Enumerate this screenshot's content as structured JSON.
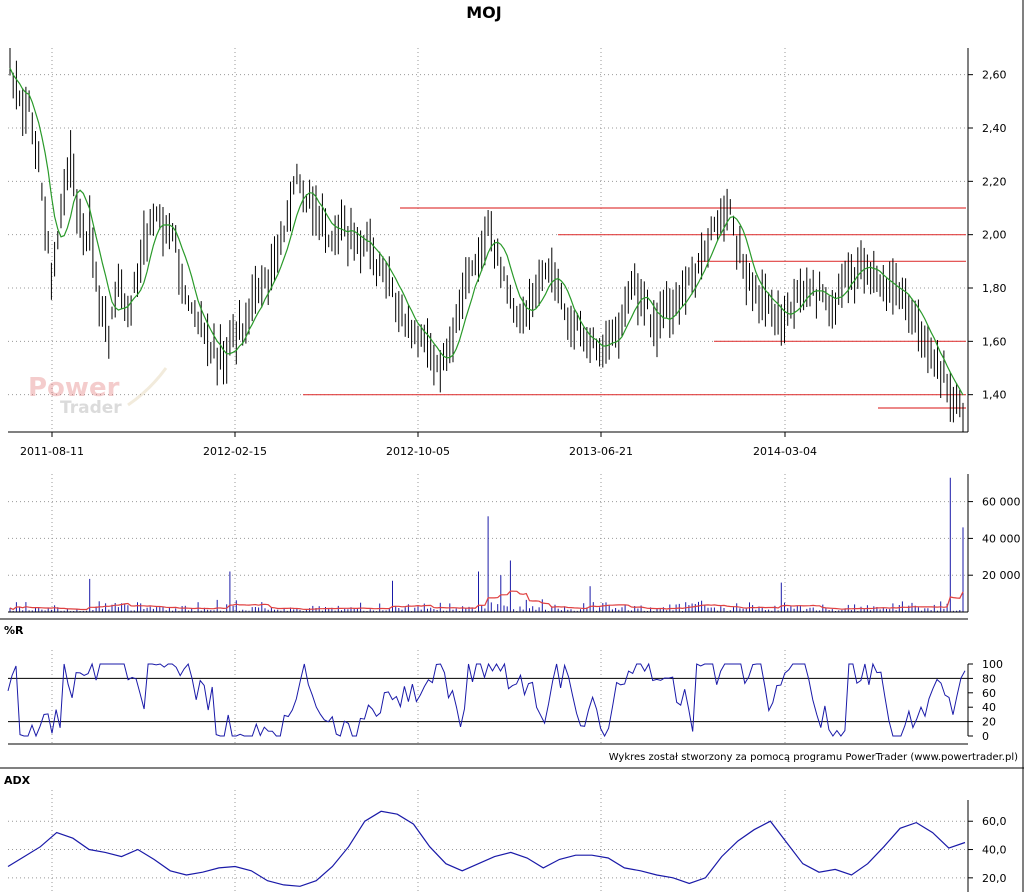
{
  "chart_data": [
    {
      "type": "ohlc",
      "title": "MOJ",
      "x_tick_labels": [
        "2011-08-11",
        "2012-02-15",
        "2012-10-05",
        "2013-06-21",
        "2014-03-04"
      ],
      "y_ticks": [
        "1,40",
        "1,60",
        "1,80",
        "2,00",
        "2,20",
        "2,40",
        "2,60"
      ],
      "ylim": [
        1.26,
        2.7
      ],
      "grid": true,
      "price_close": [
        2.62,
        2.55,
        2.45,
        2.48,
        2.35,
        2.2,
        2.0,
        1.82,
        2.05,
        2.2,
        2.28,
        2.1,
        1.98,
        2.02,
        1.85,
        1.72,
        1.6,
        1.75,
        1.8,
        1.7,
        1.78,
        1.9,
        2.0,
        2.05,
        2.1,
        1.98,
        2.02,
        1.95,
        1.8,
        1.75,
        1.7,
        1.65,
        1.6,
        1.58,
        1.55,
        1.52,
        1.6,
        1.62,
        1.65,
        1.72,
        1.78,
        1.8,
        1.85,
        1.9,
        1.98,
        2.05,
        2.18,
        2.2,
        2.15,
        2.1,
        2.08,
        2.05,
        1.98,
        2.02,
        2.06,
        2.0,
        1.98,
        1.96,
        1.95,
        1.92,
        1.88,
        1.85,
        1.8,
        1.72,
        1.7,
        1.65,
        1.62,
        1.6,
        1.58,
        1.55,
        1.5,
        1.56,
        1.62,
        1.75,
        1.8,
        1.85,
        1.9,
        1.98,
        2.05,
        1.95,
        1.85,
        1.8,
        1.72,
        1.68,
        1.7,
        1.75,
        1.8,
        1.85,
        1.88,
        1.8,
        1.72,
        1.66,
        1.65,
        1.63,
        1.6,
        1.58,
        1.57,
        1.6,
        1.62,
        1.65,
        1.72,
        1.8,
        1.78,
        1.75,
        1.7,
        1.66,
        1.68,
        1.72,
        1.75,
        1.78,
        1.8,
        1.85,
        1.9,
        1.95,
        2.0,
        2.05,
        2.08,
        2.1,
        2.02,
        1.88,
        1.85,
        1.8,
        1.78,
        1.75,
        1.7,
        1.7,
        1.68,
        1.72,
        1.75,
        1.78,
        1.8,
        1.78,
        1.75,
        1.72,
        1.76,
        1.8,
        1.86,
        1.88,
        1.86,
        1.9,
        1.88,
        1.85,
        1.82,
        1.8,
        1.78,
        1.76,
        1.74,
        1.7,
        1.66,
        1.62,
        1.56,
        1.5,
        1.45,
        1.4,
        1.36,
        1.32
      ],
      "ma_line_color": "#2a9a2a",
      "horizontal_lines": [
        {
          "value": 2.1,
          "color": "#e04040"
        },
        {
          "value": 2.0,
          "color": "#e04040"
        },
        {
          "value": 1.9,
          "color": "#e04040"
        },
        {
          "value": 1.6,
          "color": "#e04040"
        },
        {
          "value": 1.4,
          "color": "#e04040"
        },
        {
          "value": 1.35,
          "color": "#e04040"
        }
      ],
      "watermark": {
        "line1": "Power",
        "line2": "Trader"
      }
    },
    {
      "type": "bar",
      "name": "volume",
      "y_ticks": [
        "20 000",
        "40 000",
        "60 000"
      ],
      "ylim": [
        0,
        75000
      ],
      "spikes": [
        {
          "pos": 0.085,
          "value": 18000
        },
        {
          "pos": 0.23,
          "value": 22000
        },
        {
          "pos": 0.4,
          "value": 17000
        },
        {
          "pos": 0.49,
          "value": 22000
        },
        {
          "pos": 0.5,
          "value": 52000
        },
        {
          "pos": 0.515,
          "value": 20000
        },
        {
          "pos": 0.525,
          "value": 28000
        },
        {
          "pos": 0.61,
          "value": 14000
        },
        {
          "pos": 0.81,
          "value": 16000
        },
        {
          "pos": 0.985,
          "value": 73000
        },
        {
          "pos": 0.999,
          "value": 46000
        }
      ],
      "bar_color": "#1a1aa8",
      "avg_color": "#e04040"
    },
    {
      "type": "line",
      "label": "%R",
      "y_ticks": [
        "0",
        "20",
        "40",
        "60",
        "80",
        "100"
      ],
      "ylim": [
        0,
        100
      ],
      "reference_lines": [
        20,
        80
      ],
      "line_color": "#1a1aa8"
    },
    {
      "type": "line",
      "label": "ADX",
      "y_ticks": [
        "20,0",
        "40,0",
        "60,0"
      ],
      "ylim": [
        10,
        75
      ],
      "values": [
        28,
        35,
        42,
        52,
        48,
        40,
        38,
        35,
        40,
        33,
        25,
        22,
        24,
        27,
        28,
        25,
        18,
        15,
        14,
        18,
        28,
        42,
        60,
        67,
        65,
        58,
        42,
        30,
        25,
        30,
        35,
        38,
        34,
        27,
        33,
        36,
        36,
        34,
        27,
        25,
        22,
        20,
        16,
        20,
        35,
        46,
        54,
        60,
        45,
        30,
        24,
        26,
        22,
        30,
        42,
        55,
        59,
        52,
        41,
        45
      ],
      "line_color": "#1a1aa8"
    }
  ],
  "footer_text": "Wykres został stworzony za pomocą programu PowerTrader (www.powertrader.pl)"
}
